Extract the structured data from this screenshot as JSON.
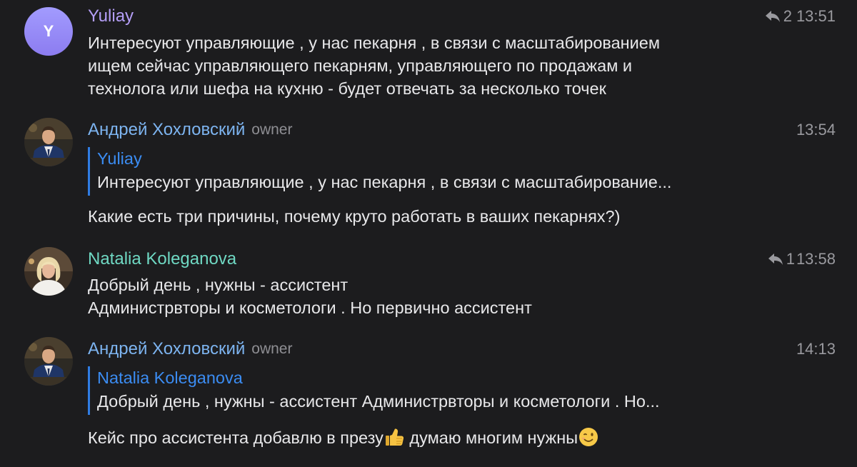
{
  "colors": {
    "background": "#1c1c1e",
    "yuliay_name": "#b49ef7",
    "andrey_name": "#7db4f0",
    "natalia_name": "#6fd8c3",
    "quote_bar": "#2f7ce3",
    "quote_author": "#3b8cf2",
    "meta": "#9a9a9f"
  },
  "messages": [
    {
      "avatar": {
        "type": "letter",
        "letter": "Y"
      },
      "author": "Yuliay",
      "role": "",
      "replies": "2",
      "time": "13:51",
      "lines": [
        "Интересуют управляющие , у нас пекарня , в связи с масштабированием",
        "ищем сейчас управляющего пекарням, управляющего по продажам и",
        "технолога или шефа на кухню - будет отвечать за несколько точек"
      ]
    },
    {
      "avatar": {
        "type": "photo",
        "icon": "man-in-suit-avatar"
      },
      "author": "Андрей Хохловский",
      "role": "owner",
      "time": "13:54",
      "quote": {
        "author": "Yuliay",
        "text": "Интересуют управляющие , у нас пекарня , в связи с масштабирование..."
      },
      "lines": [
        "Какие есть три причины, почему круто работать в ваших пекарнях?)"
      ]
    },
    {
      "avatar": {
        "type": "photo",
        "icon": "blonde-woman-avatar"
      },
      "author": "Natalia Koleganova",
      "role": "",
      "replies": "1",
      "time": "13:58",
      "lines": [
        "Добрый день , нужны - ассистент",
        "Администрвторы и косметологи . Но первично ассистент"
      ]
    },
    {
      "avatar": {
        "type": "photo",
        "icon": "man-in-suit-avatar"
      },
      "author": "Андрей Хохловский",
      "role": "owner",
      "time": "14:13",
      "quote": {
        "author": "Natalia Koleganova",
        "text": "Добрый день , нужны - ассистент  Администрвторы и косметологи . Но..."
      },
      "lines_parts": {
        "before": "Кейс про ассистента добавлю в презу",
        "middle": " думаю многим нужны",
        "emoji1": "thumbs-up-icon",
        "emoji2": "winking-face-icon"
      }
    }
  ]
}
